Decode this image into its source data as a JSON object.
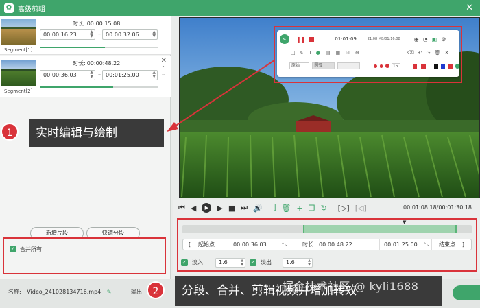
{
  "window": {
    "title": "高级剪辑"
  },
  "segments": [
    {
      "label": "Segment[1]",
      "duration_key": "时长:",
      "duration": "00:00:15.08",
      "start": "00:00:16.23",
      "end": "00:00:32.06",
      "progress": 0.55
    },
    {
      "label": "Segment[2]",
      "duration_key": "时长:",
      "duration": "00:00:48.22",
      "start": "00:00:36.03",
      "end": "00:01:25.00",
      "progress": 0.62
    }
  ],
  "left_actions": {
    "new_segment": "新增片段",
    "quick_split": "快速分段",
    "merge_all": "合并所有"
  },
  "callouts": [
    {
      "num": "1",
      "text": "实时编辑与绘制"
    },
    {
      "num": "2",
      "text": "分段、合并、剪辑视频并增加转效"
    }
  ],
  "overlay_toolbar": {
    "time": "01:01:09",
    "date": "21.08 MB/01:16:08",
    "opt1": "原始",
    "opt2": "圆弧",
    "size": "15"
  },
  "player": {
    "time": "00:01:08.18/00:01:30.18"
  },
  "range": {
    "start_label": "起始点",
    "start": "00:00:36.03",
    "duration_key": "时长:",
    "duration": "00:00:48.22",
    "end": "00:01:25.00",
    "end_label": "结束点"
  },
  "fade": {
    "fade_in_label": "淡入",
    "fade_in": "1.6",
    "fade_out_label": "淡出",
    "fade_out": "1.6"
  },
  "bottom": {
    "name_label": "名称:",
    "filename": "Video_241028134716.mp4",
    "output_label": "输出"
  },
  "watermark": "掘金技术社区 @ kyli1688",
  "colors": {
    "accent": "#3fa56b",
    "annotation_red": "#d9333a"
  }
}
